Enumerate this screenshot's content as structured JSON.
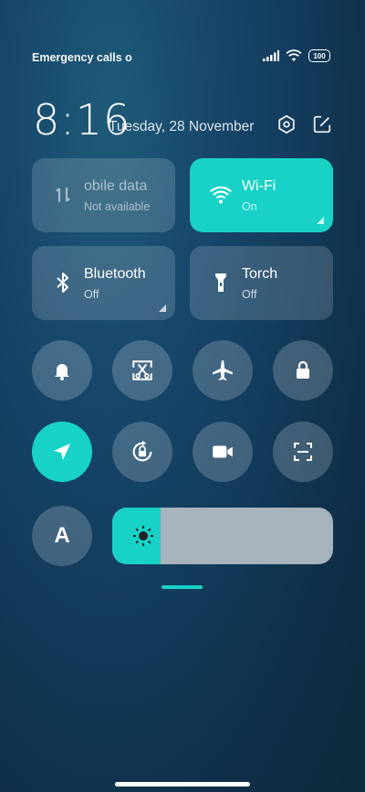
{
  "status_bar": {
    "carrier": "Emergency calls o",
    "battery": "100"
  },
  "header": {
    "time": "8:16",
    "date": "Tuesday, 28 November"
  },
  "tiles": {
    "mobile_data": {
      "title": "obile data",
      "sub": "Not available"
    },
    "wifi": {
      "title": "Wi-Fi",
      "sub": "On"
    },
    "bluetooth": {
      "title": "Bluetooth",
      "sub": "Off"
    },
    "torch": {
      "title": "Torch",
      "sub": "Off"
    }
  },
  "quick_toggles": [
    {
      "icon": "bell-icon",
      "active": false
    },
    {
      "icon": "screenshot-scissors-icon",
      "active": false
    },
    {
      "icon": "airplane-icon",
      "active": false
    },
    {
      "icon": "lock-icon",
      "active": false
    },
    {
      "icon": "location-icon",
      "active": true
    },
    {
      "icon": "rotation-lock-icon",
      "active": false
    },
    {
      "icon": "video-camera-icon",
      "active": false
    },
    {
      "icon": "scan-icon",
      "active": false
    },
    {
      "icon": "reading-mode-icon",
      "label": "A",
      "active": false
    }
  ],
  "brightness": {
    "level_percent": 22
  },
  "colors": {
    "accent": "#18d2c8",
    "tile": "rgba(255,255,255,0.16)",
    "slider_track": "#a7b3bd"
  }
}
